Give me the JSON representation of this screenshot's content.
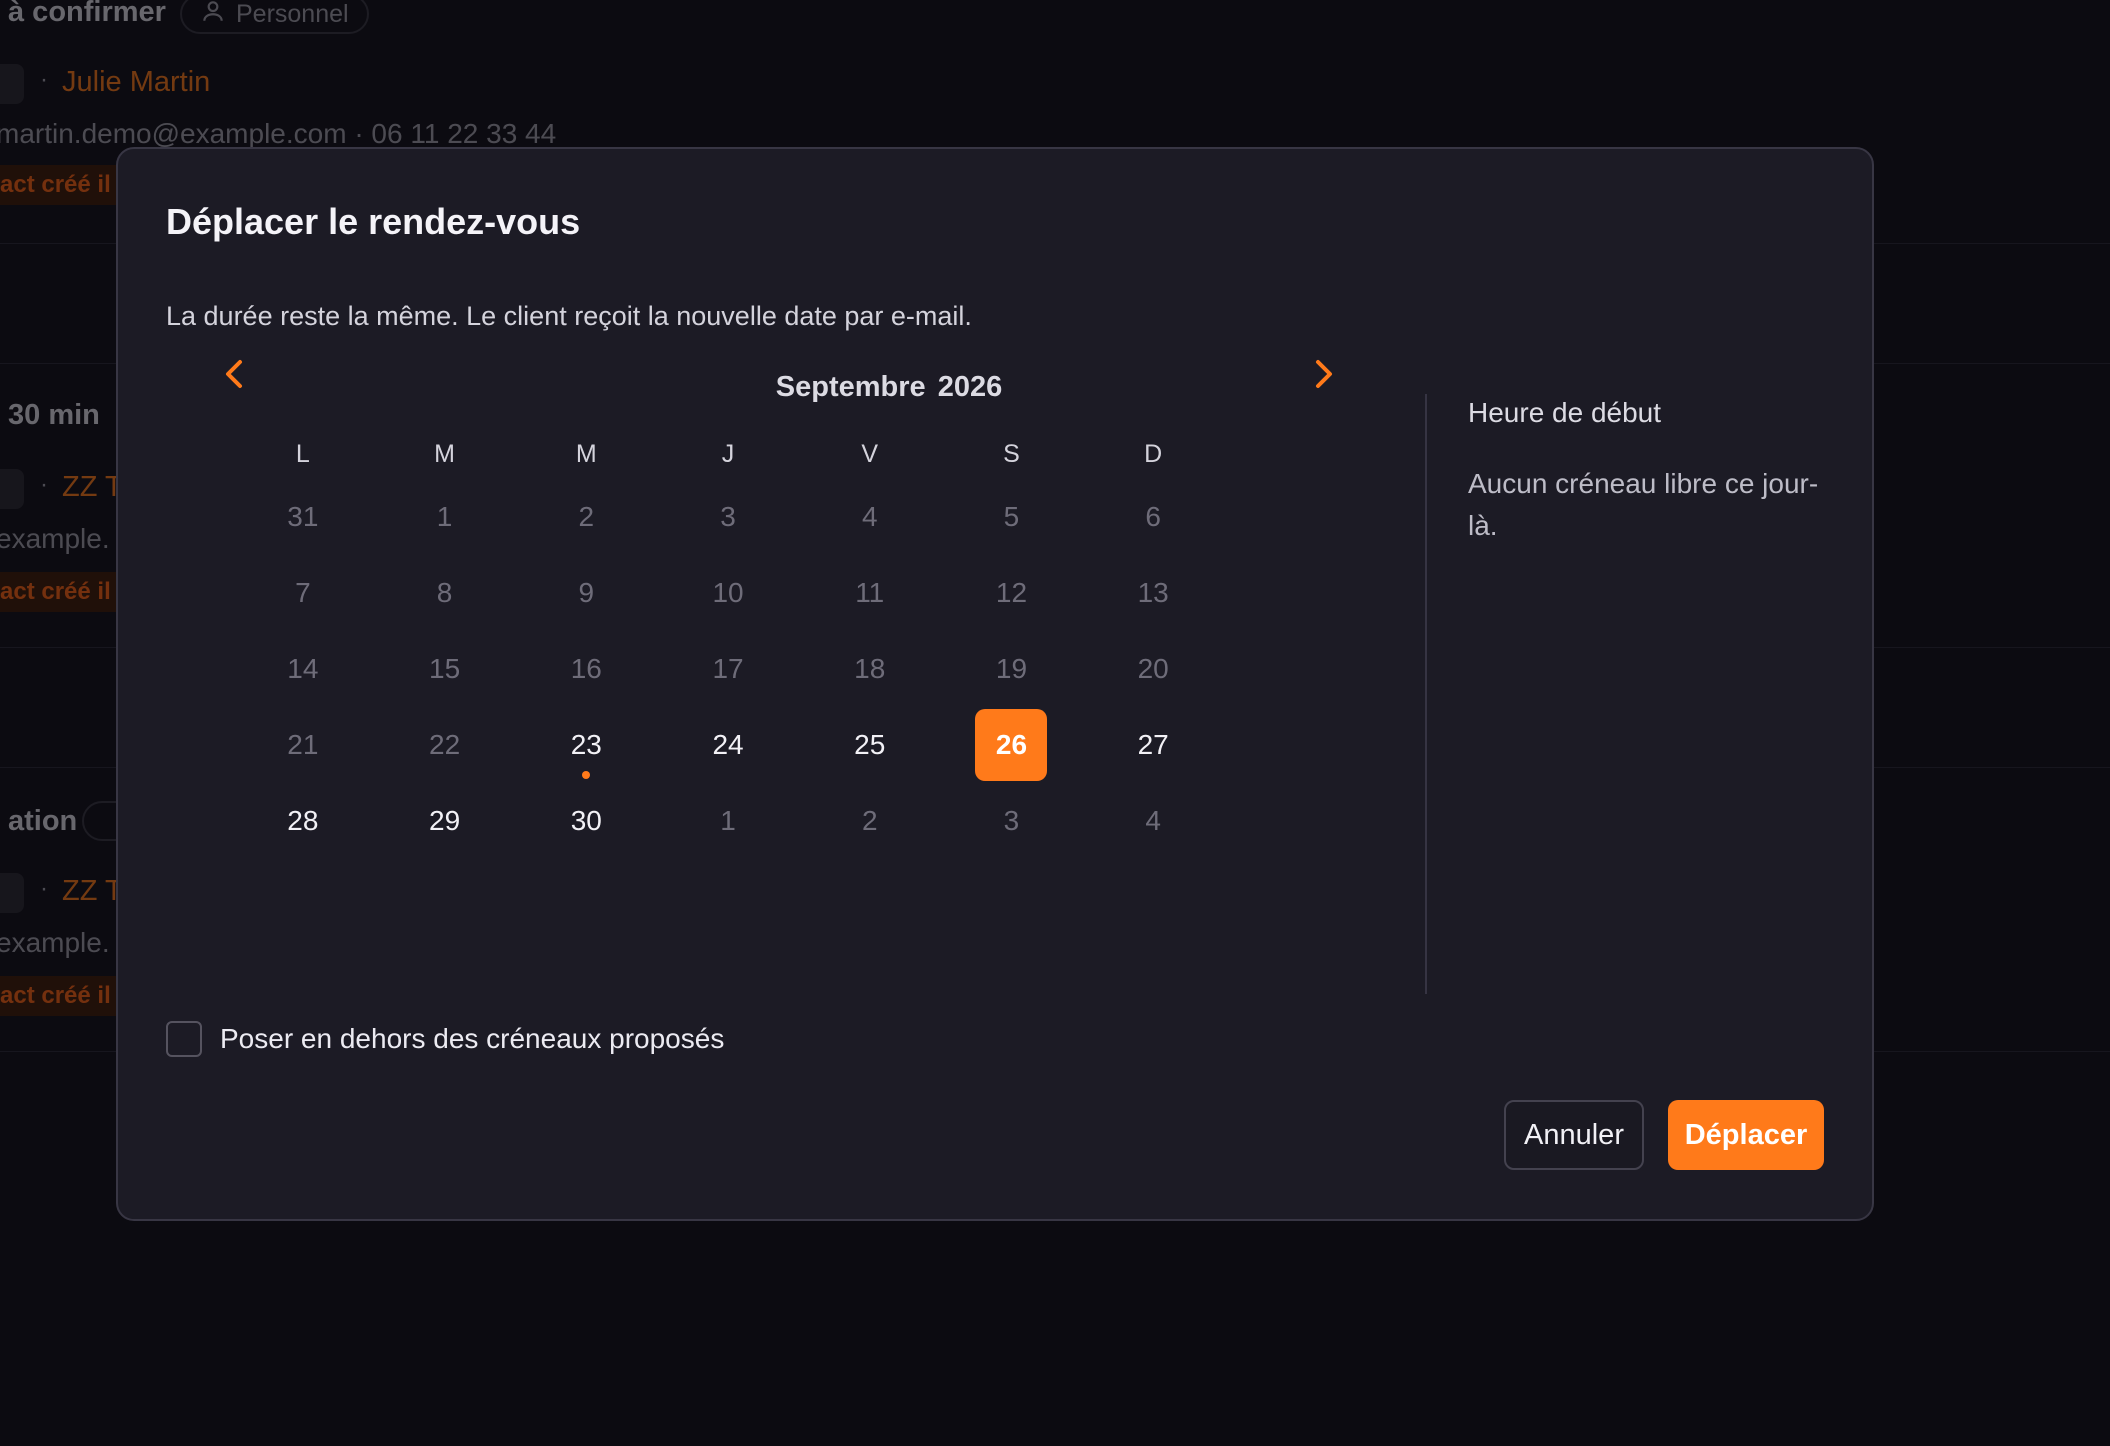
{
  "background": {
    "header": {
      "title": "à confirmer",
      "pill_label": "Personnel",
      "pill_icon": "user-icon"
    },
    "rows": [
      {
        "name": "Julie Martin",
        "contact": "martin.demo@example.com · 06 11 22 33 44",
        "badge": "act créé il"
      },
      {
        "duration": "30 min",
        "name": "ZZ T",
        "contact": "example.",
        "badge": "act créé il"
      },
      {
        "title": "ation",
        "name": "ZZ T",
        "contact": "example.",
        "badge": "act créé il"
      }
    ]
  },
  "modal": {
    "title": "Déplacer le rendez-vous",
    "description": "La durée reste la même. Le client reçoit la nouvelle date par e-mail.",
    "calendar": {
      "month": "Septembre",
      "year": "2026",
      "prev_icon": "chevron-left-icon",
      "next_icon": "chevron-right-icon",
      "weekdays": [
        "L",
        "M",
        "M",
        "J",
        "V",
        "S",
        "D"
      ],
      "weeks": [
        [
          {
            "d": "31",
            "s": "muted"
          },
          {
            "d": "1",
            "s": "muted"
          },
          {
            "d": "2",
            "s": "muted"
          },
          {
            "d": "3",
            "s": "muted"
          },
          {
            "d": "4",
            "s": "muted"
          },
          {
            "d": "5",
            "s": "muted"
          },
          {
            "d": "6",
            "s": "muted"
          }
        ],
        [
          {
            "d": "7",
            "s": "muted"
          },
          {
            "d": "8",
            "s": "muted"
          },
          {
            "d": "9",
            "s": "muted"
          },
          {
            "d": "10",
            "s": "muted"
          },
          {
            "d": "11",
            "s": "muted"
          },
          {
            "d": "12",
            "s": "muted"
          },
          {
            "d": "13",
            "s": "muted"
          }
        ],
        [
          {
            "d": "14",
            "s": "muted"
          },
          {
            "d": "15",
            "s": "muted"
          },
          {
            "d": "16",
            "s": "muted"
          },
          {
            "d": "17",
            "s": "muted"
          },
          {
            "d": "18",
            "s": "muted"
          },
          {
            "d": "19",
            "s": "muted"
          },
          {
            "d": "20",
            "s": "muted"
          }
        ],
        [
          {
            "d": "21",
            "s": "muted"
          },
          {
            "d": "22",
            "s": "muted"
          },
          {
            "d": "23",
            "s": "avail",
            "today": true
          },
          {
            "d": "24",
            "s": "avail"
          },
          {
            "d": "25",
            "s": "avail"
          },
          {
            "d": "26",
            "s": "selected"
          },
          {
            "d": "27",
            "s": "avail"
          }
        ],
        [
          {
            "d": "28",
            "s": "avail"
          },
          {
            "d": "29",
            "s": "avail"
          },
          {
            "d": "30",
            "s": "avail"
          },
          {
            "d": "1",
            "s": "muted"
          },
          {
            "d": "2",
            "s": "muted"
          },
          {
            "d": "3",
            "s": "muted"
          },
          {
            "d": "4",
            "s": "muted"
          }
        ]
      ]
    },
    "time_panel": {
      "heading": "Heure de début",
      "empty_message": "Aucun créneau libre ce jour-là."
    },
    "outside_checkbox": {
      "label": "Poser en dehors des créneaux proposés",
      "checked": false
    },
    "buttons": {
      "cancel": "Annuler",
      "confirm": "Déplacer"
    }
  },
  "colors": {
    "accent": "#ff7a1a",
    "modal_bg": "#1c1b25",
    "page_bg": "#0c0b11"
  }
}
